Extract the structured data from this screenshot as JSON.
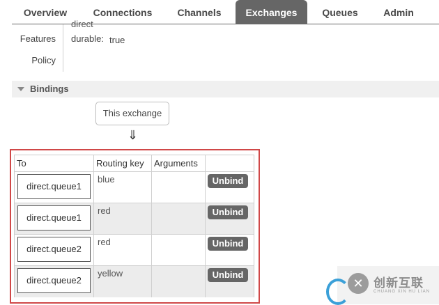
{
  "nav": {
    "tabs": [
      {
        "label": "Overview",
        "active": false
      },
      {
        "label": "Connections",
        "active": false
      },
      {
        "label": "Channels",
        "active": false
      },
      {
        "label": "Exchanges",
        "active": true
      },
      {
        "label": "Queues",
        "active": false
      },
      {
        "label": "Admin",
        "active": false
      }
    ]
  },
  "props": {
    "type_value_clipped": "direct",
    "features_label": "Features",
    "feature_key": "durable:",
    "feature_value": "true",
    "policy_label": "Policy"
  },
  "bindings": {
    "section_title": "Bindings",
    "source_label": "This exchange",
    "arrow": "⇓",
    "headers": {
      "to": "To",
      "routing_key": "Routing key",
      "arguments": "Arguments"
    },
    "rows": [
      {
        "queue": "direct.queue1",
        "routing_key": "blue",
        "arguments": "",
        "action": "Unbind"
      },
      {
        "queue": "direct.queue1",
        "routing_key": "red",
        "arguments": "",
        "action": "Unbind"
      },
      {
        "queue": "direct.queue2",
        "routing_key": "red",
        "arguments": "",
        "action": "Unbind"
      },
      {
        "queue": "direct.queue2",
        "routing_key": "yellow",
        "arguments": "",
        "action": "Unbind"
      }
    ]
  },
  "watermark": {
    "icon": "brand-logo-icon",
    "text_cn": "创新互联",
    "text_en": "CHUANG XIN HU LIAN"
  },
  "colors": {
    "active_tab_bg": "#666666",
    "highlight_border": "#d04848",
    "unbind_bg": "#666666"
  }
}
